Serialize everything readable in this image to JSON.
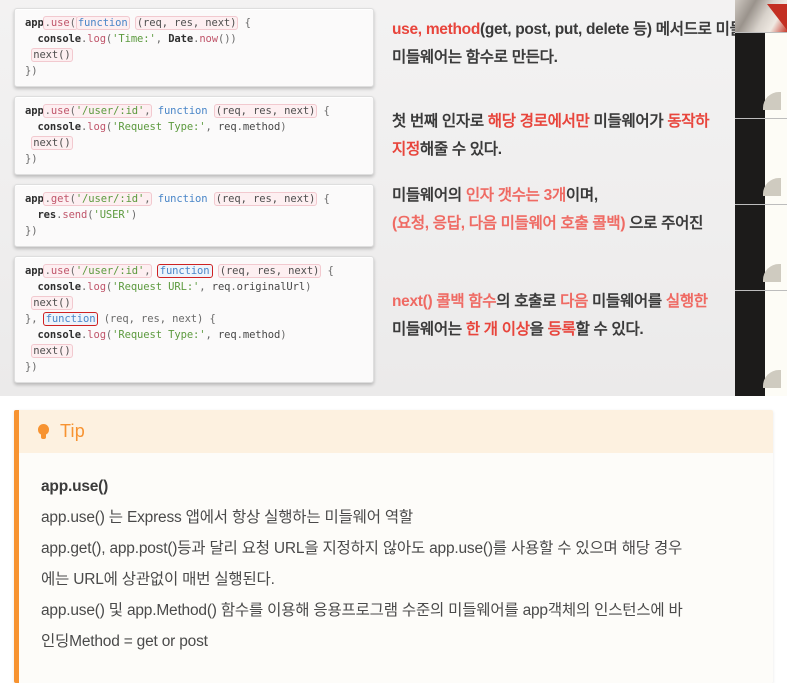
{
  "slide": {
    "code_blocks": [
      {
        "id": "block-app-use-function",
        "lines": [
          "app.use(function (req, res, next) {",
          "  console.log('Time:', Date.now())",
          "  next()",
          "})"
        ]
      },
      {
        "id": "block-app-use-path",
        "lines": [
          "app.use('/user/:id', function (req, res, next) {",
          "  console.log('Request Type:', req.method)",
          "  next()",
          "})"
        ]
      },
      {
        "id": "block-app-get-path",
        "lines": [
          "app.get('/user/:id', function (req, res, next) {",
          "  res.send('USER')",
          "})"
        ]
      },
      {
        "id": "block-app-use-multi",
        "lines": [
          "app.use('/user/:id', function (req, res, next) {",
          "  console.log('Request URL:', req.originalUrl)",
          "  next()",
          "}, function (req, res, next) {",
          "  console.log('Request Type:', req.method)",
          "  next()",
          "})"
        ]
      }
    ],
    "notes": [
      {
        "id": "note-use-method",
        "line1_a": "use, method",
        "line1_b": "(get, post, put, delete 등) 메서드로 미들웨어를",
        "line2": "미들웨어는 함수로 만든다."
      },
      {
        "id": "note-first-arg",
        "line1_a": "첫 번째 인자로 ",
        "line1_b": "해당 경로에서만",
        "line1_c": " 미들웨어가 ",
        "line1_d": "동작하",
        "line2_a": "지정",
        "line2_b": "해줄 수 있다."
      },
      {
        "id": "note-arg-count",
        "line1_a": "미들웨어의 ",
        "line1_b": "인자 갯수는 3개",
        "line1_c": "이며,",
        "line2_a": "(요청, 응답, 다음 미들웨어 호출 콜백)",
        "line2_b": " 으로 주어진"
      },
      {
        "id": "note-next-callback",
        "line1_a": "next() 콜백 함수",
        "line1_b": "의 호출로 ",
        "line1_c": "다음",
        "line1_d": " 미들웨어를 ",
        "line1_e": "실행한",
        "line2_a": "미들웨어는 ",
        "line2_b": "한 개 이상",
        "line2_c": "을 ",
        "line2_d": "등록",
        "line2_e": "할 수 있다."
      }
    ]
  },
  "tip": {
    "icon": "lightbulb-icon",
    "title": "Tip",
    "heading": "app.use()",
    "lines": [
      "app.use() 는 Express 앱에서 항상 실행하는 미들웨어 역할",
      "app.get(), app.post()등과 달리 요청 URL을 지정하지 않아도 app.use()를 사용할 수 있으며 해당 경우",
      "에는 URL에 상관없이 매번 실행된다.",
      "app.use() 및 app.Method() 함수를 이용해 응용프로그램 수준의 미들웨어를 app객체의 인스턴스에 바",
      "인딩Method = get or post"
    ]
  },
  "colors": {
    "accent_orange": "#f79331",
    "note_red": "#e8453c",
    "note_rose": "#ef6a63",
    "annotation_box_red": "#cf2222",
    "slide_bg": "#efeeee"
  }
}
